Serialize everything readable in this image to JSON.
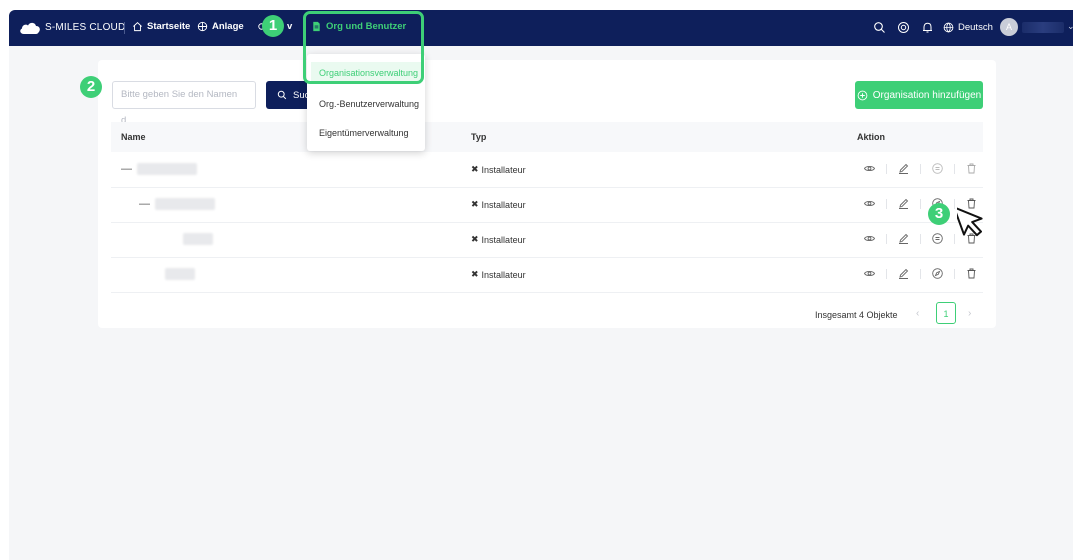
{
  "topbar": {
    "brand": "S-MILES CLOUD",
    "nav": [
      {
        "label": "Startseite",
        "icon": "home-icon"
      },
      {
        "label": "Anlage",
        "icon": "globe-icon"
      },
      {
        "label": "v",
        "icon": "settings-icon"
      },
      {
        "label": "Org und Benutzer",
        "icon": "document-icon"
      }
    ],
    "language": "Deutsch",
    "avatar_initial": "A",
    "icons": [
      "search-icon",
      "help-icon",
      "bell-icon",
      "globe-icon"
    ]
  },
  "dropdown": {
    "items": [
      "Organisationsverwaltung",
      "Org.-Benutzerverwaltung",
      "Eigentümerverwaltung"
    ]
  },
  "search": {
    "placeholder": "Bitte geben Sie den Namen d...",
    "button_label": "Suc"
  },
  "add_button_label": "Organisation hinzufügen",
  "table": {
    "columns": [
      "Name",
      "Typ",
      "Aktion"
    ],
    "rows": [
      {
        "typ": "Installateur"
      },
      {
        "typ": "Installateur"
      },
      {
        "typ": "Installateur"
      },
      {
        "typ": "Installateur"
      }
    ]
  },
  "pagination": {
    "total": "Insgesamt 4 Objekte",
    "current_page": "1"
  },
  "callouts": [
    "1",
    "2",
    "3"
  ],
  "colors": {
    "topbar": "#0e1f5b",
    "accent": "#3ecf77",
    "background": "#f5f6f8"
  }
}
